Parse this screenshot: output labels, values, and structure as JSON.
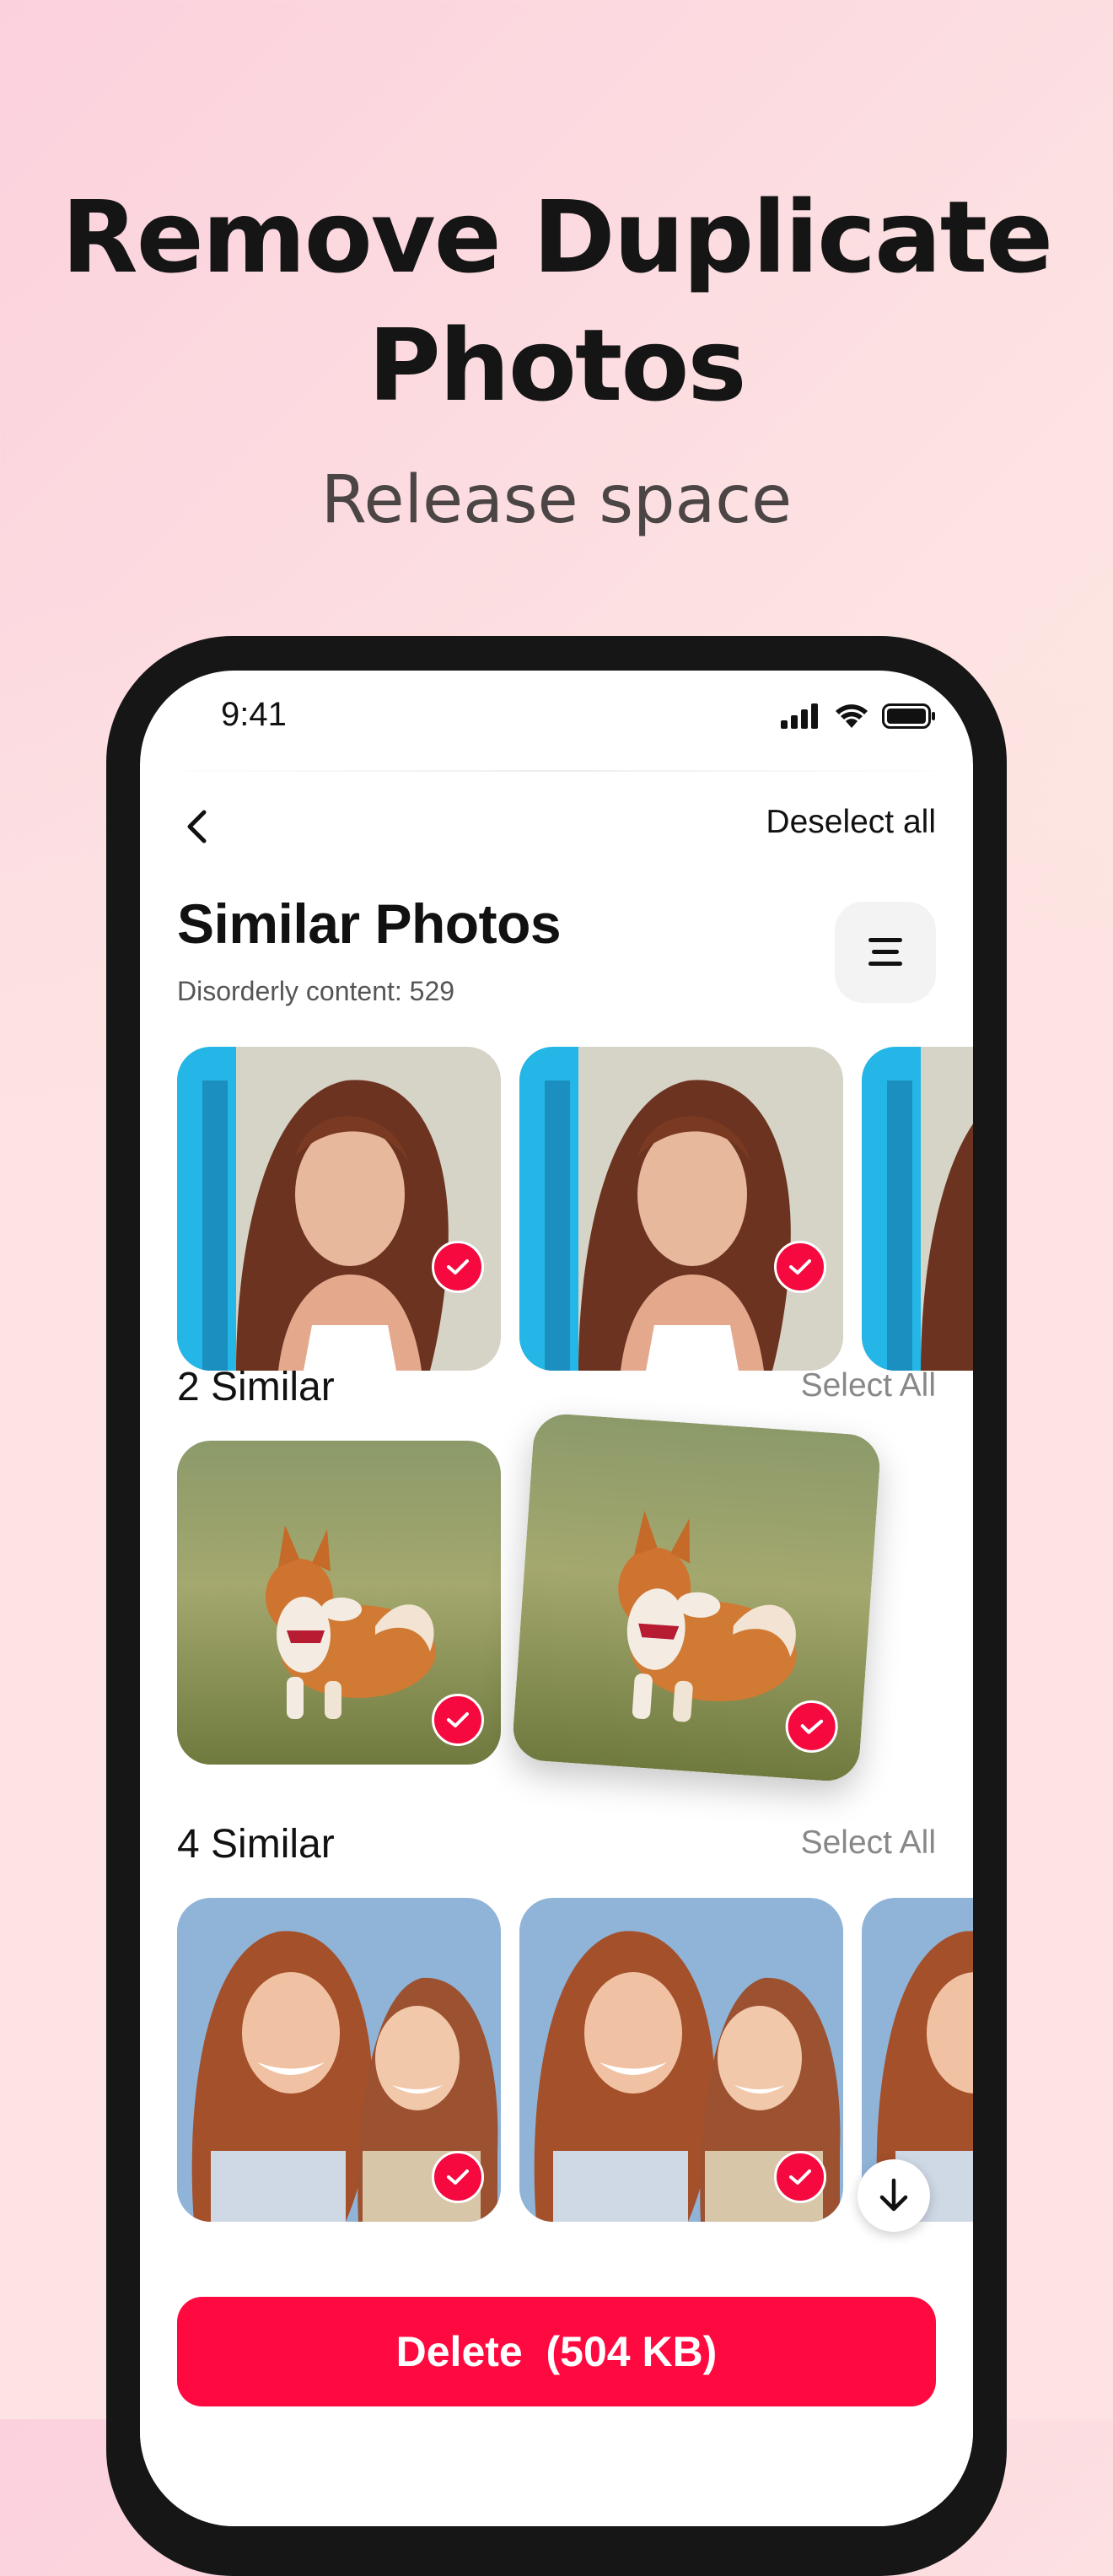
{
  "headline": {
    "line1": "Remove Duplicate",
    "line2": "Photos",
    "subline": "Release space"
  },
  "status": {
    "time": "9:41"
  },
  "nav": {
    "deselect_label": "Deselect all"
  },
  "header": {
    "title": "Similar Photos",
    "subtitle": "Disorderly content: 529"
  },
  "groups": [
    {
      "title": "2 Similar",
      "action": "Select All"
    },
    {
      "title": "4 Similar",
      "action": "Select All"
    }
  ],
  "delete_button": {
    "label": "Delete  (504 KB)"
  },
  "colors": {
    "accent": "#ff0a40",
    "check": "#f5093f"
  }
}
